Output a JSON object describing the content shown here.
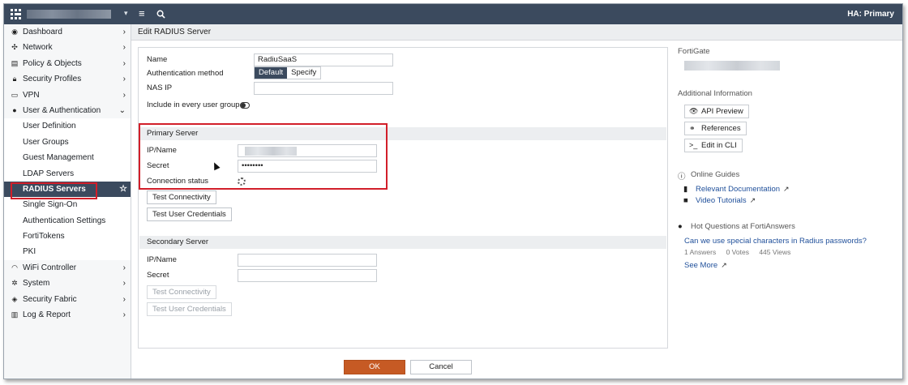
{
  "topbar": {
    "ha_status": "HA: Primary",
    "icons": {
      "logo": "fortinet-logo-icon",
      "menu": "hamburger-menu-icon",
      "search": "search-icon"
    }
  },
  "sidebar": {
    "items": [
      {
        "label": "Dashboard",
        "icon": "dashboard-icon",
        "arrow": "›"
      },
      {
        "label": "Network",
        "icon": "network-icon",
        "arrow": "›"
      },
      {
        "label": "Policy & Objects",
        "icon": "policy-icon",
        "arrow": "›"
      },
      {
        "label": "Security Profiles",
        "icon": "lock-icon",
        "arrow": "›"
      },
      {
        "label": "VPN",
        "icon": "vpn-icon",
        "arrow": "›"
      },
      {
        "label": "User & Authentication",
        "icon": "user-icon",
        "arrow": "⌄"
      },
      {
        "label": "User Definition"
      },
      {
        "label": "User Groups"
      },
      {
        "label": "Guest Management"
      },
      {
        "label": "LDAP Servers"
      },
      {
        "label": "RADIUS Servers"
      },
      {
        "label": "Single Sign-On"
      },
      {
        "label": "Authentication Settings"
      },
      {
        "label": "FortiTokens"
      },
      {
        "label": "PKI"
      },
      {
        "label": "WiFi Controller",
        "icon": "wifi-icon",
        "arrow": "›"
      },
      {
        "label": "System",
        "icon": "gear-icon",
        "arrow": "›"
      },
      {
        "label": "Security Fabric",
        "icon": "fabric-icon",
        "arrow": "›"
      },
      {
        "label": "Log & Report",
        "icon": "chart-icon",
        "arrow": "›"
      }
    ],
    "active": "RADIUS Servers",
    "star": "☆"
  },
  "page": {
    "title": "Edit RADIUS Server"
  },
  "form": {
    "name_label": "Name",
    "name_value": "RadiuSaaS",
    "auth_method_label": "Authentication method",
    "auth_default": "Default",
    "auth_specify": "Specify",
    "nas_ip_label": "NAS IP",
    "nas_ip_value": "",
    "include_label": "Include in every user group",
    "include_enabled": false,
    "primary": {
      "heading": "Primary Server",
      "ip_label": "IP/Name",
      "secret_label": "Secret",
      "secret_value": "••••••••",
      "status_label": "Connection status",
      "test_connectivity": "Test Connectivity",
      "test_credentials": "Test User Credentials"
    },
    "secondary": {
      "heading": "Secondary Server",
      "ip_label": "IP/Name",
      "secret_label": "Secret",
      "test_connectivity": "Test Connectivity",
      "test_credentials": "Test User Credentials"
    },
    "ok": "OK",
    "cancel": "Cancel"
  },
  "info": {
    "device_label": "FortiGate",
    "additional_label": "Additional Information",
    "api_preview": "API Preview",
    "references": "References",
    "edit_cli": "Edit in CLI",
    "guides_label": "Online Guides",
    "relevant_docs": "Relevant Documentation",
    "video_tutorials": "Video Tutorials",
    "hot_questions_label": "Hot Questions at FortiAnswers",
    "question": "Can we use special characters in Radius passwords?",
    "answers": "1 Answers",
    "votes": "0 Votes",
    "views": "445 Views",
    "see_more": "See More"
  }
}
